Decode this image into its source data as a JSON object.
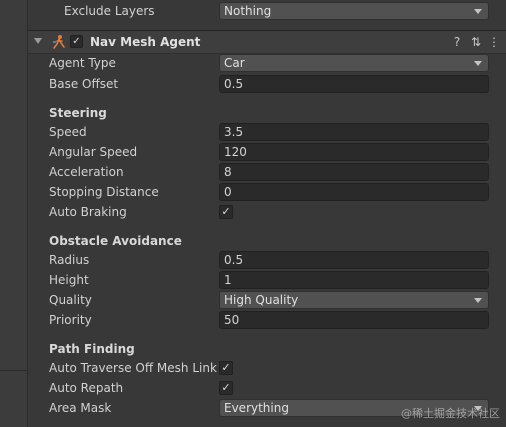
{
  "top": {
    "label": "Exclude Layers",
    "value": "Nothing"
  },
  "component": {
    "title": "Nav Mesh Agent",
    "enabled_mark": "✓",
    "help_glyph": "?",
    "presets_glyph": "⇅",
    "menu_glyph": "⋮"
  },
  "agent": {
    "agent_type_label": "Agent Type",
    "agent_type_value": "Car",
    "base_offset_label": "Base Offset",
    "base_offset_value": "0.5"
  },
  "steering": {
    "title": "Steering",
    "speed_label": "Speed",
    "speed_value": "3.5",
    "angular_speed_label": "Angular Speed",
    "angular_speed_value": "120",
    "acceleration_label": "Acceleration",
    "acceleration_value": "8",
    "stopping_distance_label": "Stopping Distance",
    "stopping_distance_value": "0",
    "auto_braking_label": "Auto Braking",
    "auto_braking_checked": true
  },
  "obstacle": {
    "title": "Obstacle Avoidance",
    "radius_label": "Radius",
    "radius_value": "0.5",
    "height_label": "Height",
    "height_value": "1",
    "quality_label": "Quality",
    "quality_value": "High Quality",
    "priority_label": "Priority",
    "priority_value": "50"
  },
  "path": {
    "title": "Path Finding",
    "auto_traverse_label": "Auto Traverse Off Mesh Link",
    "auto_traverse_checked": true,
    "auto_repath_label": "Auto Repath",
    "auto_repath_checked": true,
    "area_mask_label": "Area Mask",
    "area_mask_value": "Everything"
  },
  "check_mark": "✓",
  "watermark": "@稀土掘金技术社区",
  "colors": {
    "panel_bg": "#383838",
    "field_bg": "#2a2a2a",
    "dropdown_bg": "#515151",
    "text": "#d2d2d2"
  }
}
